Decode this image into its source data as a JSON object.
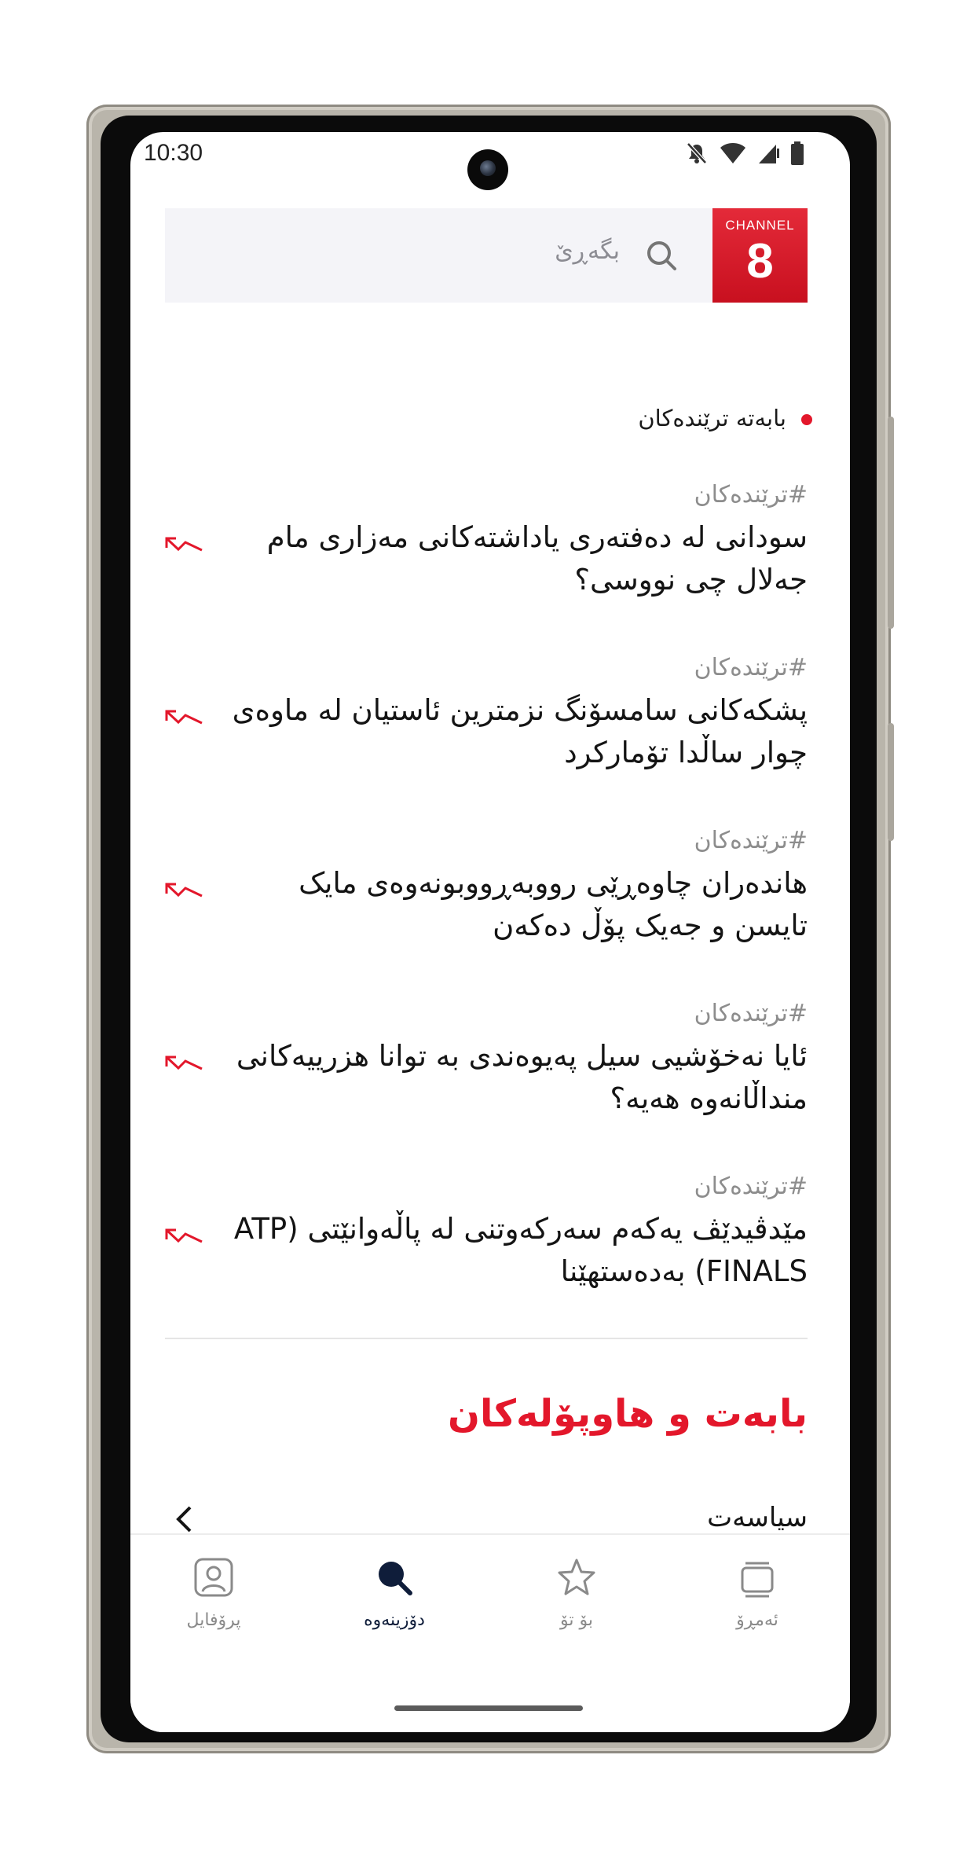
{
  "status_bar": {
    "time": "10:30"
  },
  "header": {
    "search_placeholder": "بگەڕێ",
    "logo_word": "CHANNEL",
    "logo_number": "8"
  },
  "trending": {
    "heading": "بابەتە ترێندەکان",
    "items": [
      {
        "tag": "#ترێندەکان",
        "title": "سودانی لە دەفتەری یاداشتەکانی مەزاری مام جەلال چی نووسی؟"
      },
      {
        "tag": "#ترێندەکان",
        "title": "پشکەکانی سامسۆنگ نزمترین ئاستیان لە ماوەی چوار ساڵدا تۆمارکرد"
      },
      {
        "tag": "#ترێندەکان",
        "title": "هاندەران چاوەڕێی رووبەڕووبونەوەی مایک تایسن و جەیک پۆڵ دەکەن"
      },
      {
        "tag": "#ترێندەکان",
        "title": "ئایا نەخۆشیی سیل پەیوەندی بە توانا هزرییەکانی منداڵانەوە هەیە؟"
      },
      {
        "tag": "#ترێندەکان",
        "title": "مێدڤیدێڤ یەکەم سەرکەوتنی لە پاڵەوانێتی (ATP FINALS) بەدەستهێنا"
      }
    ]
  },
  "topics": {
    "title": "بابەت و هاوپۆلەکان",
    "first_category": "سیاسەت"
  },
  "bottom_nav": {
    "items": [
      {
        "label": "پرۆفایل",
        "icon": "profile-icon"
      },
      {
        "label": "دۆزینەوە",
        "icon": "search-icon"
      },
      {
        "label": "بۆ تۆ",
        "icon": "star-icon"
      },
      {
        "label": "ئەمڕۆ",
        "icon": "stack-icon"
      }
    ],
    "active": "دۆزینەوە"
  },
  "colors": {
    "accent": "#e3172b",
    "active_nav": "#0f1d3a",
    "search_bg": "#f4f4f8"
  }
}
